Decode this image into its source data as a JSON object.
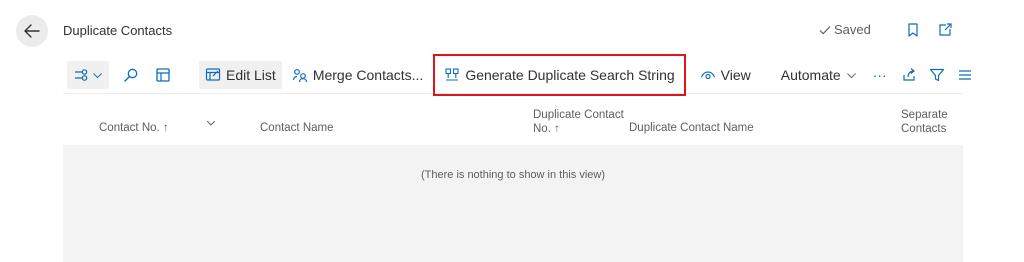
{
  "header": {
    "title": "Duplicate Contacts",
    "status": "Saved"
  },
  "toolbar": {
    "edit_list": "Edit List",
    "merge_contacts": "Merge Contacts...",
    "generate": "Generate Duplicate Search String",
    "view": "View",
    "automate": "Automate",
    "more": "···"
  },
  "table": {
    "columns": [
      {
        "line1": "Contact No.",
        "line2": "",
        "sort": "↑"
      },
      {
        "line1": "Contact Name",
        "line2": "",
        "sort": ""
      },
      {
        "line1": "Duplicate Contact",
        "line2": "No.",
        "sort": "↑"
      },
      {
        "line1": "Duplicate Contact Name",
        "line2": "",
        "sort": ""
      },
      {
        "line1": "Separate",
        "line2": "Contacts",
        "sort": ""
      }
    ],
    "rows": [],
    "empty_message": "(There is nothing to show in this view)"
  },
  "colors": {
    "accent": "#0f6cbd",
    "focus_border": "#e0141e",
    "grid_background": "#f3f3f3"
  }
}
